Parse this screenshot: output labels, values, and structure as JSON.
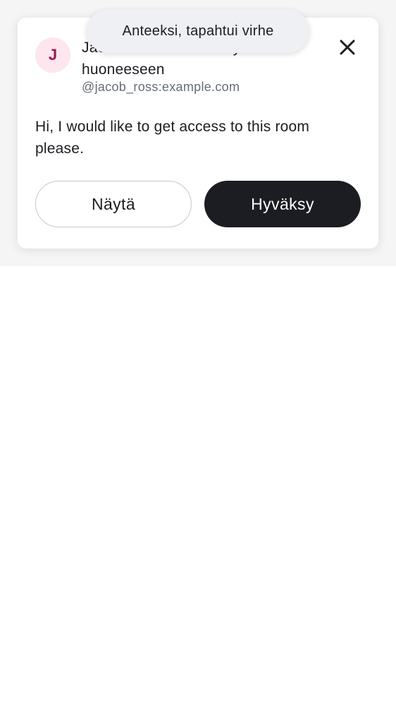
{
  "notification": {
    "avatar_initial": "J",
    "title": "Jacob Ross haluaa liittyä tähän huoneeseen",
    "user_id": "@jacob_ross:example.com",
    "message": "Hi, I would like to get access to this room please.",
    "view_label": "Näytä",
    "accept_label": "Hyväksy",
    "close_icon": "close-icon"
  },
  "toast": {
    "text": "Anteeksi, tapahtui virhe"
  },
  "colors": {
    "avatar_bg": "#fde6ee",
    "avatar_text": "#9b1a4f",
    "accept_bg": "#1b1d22",
    "secondary_text": "#656d77"
  }
}
